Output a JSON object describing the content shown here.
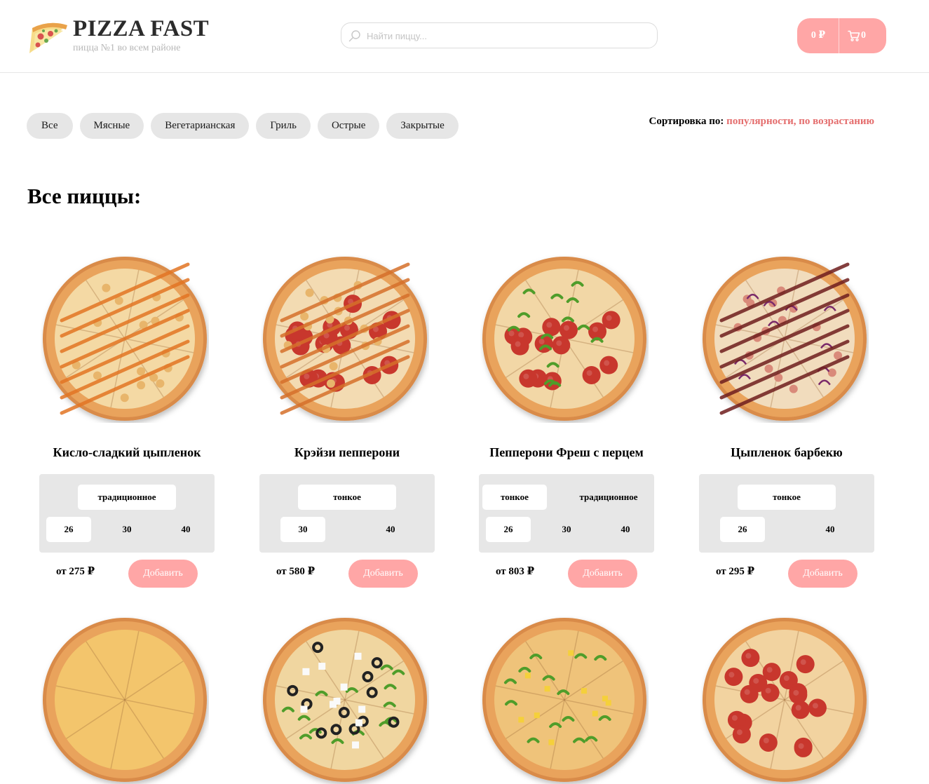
{
  "header": {
    "brand_title": "PIZZA FAST",
    "brand_subtitle": "пицца №1 во всем районе",
    "search_placeholder": "Найти пиццу...",
    "cart_total": "0 ₽",
    "cart_count": "0"
  },
  "categories": [
    "Все",
    "Мясные",
    "Вегетарианская",
    "Гриль",
    "Острые",
    "Закрытые"
  ],
  "sort": {
    "label": "Сортировка по:",
    "value": "популярности, по возрастанию"
  },
  "section_title": "Все пиццы:",
  "add_label": "Добавить",
  "colors": {
    "accent": "#ffa6a6",
    "sort_accent": "#e46c6c",
    "chip_bg": "#e6e6e6"
  },
  "pizzas": [
    {
      "name": "Кисло-сладкий цыпленок",
      "price": "от 275 ₽",
      "doughs": [
        {
          "label": "традиционное",
          "active": true
        }
      ],
      "sizes": [
        {
          "label": "26",
          "active": true
        },
        {
          "label": "30",
          "active": false
        },
        {
          "label": "40",
          "active": false
        }
      ],
      "topping": "sweet-sour-chicken"
    },
    {
      "name": "Крэйзи пепперони",
      "price": "от 580 ₽",
      "doughs": [
        {
          "label": "тонкое",
          "active": true
        }
      ],
      "sizes": [
        {
          "label": "30",
          "active": true
        },
        {
          "label": "40",
          "active": false
        }
      ],
      "topping": "crazy-pepperoni"
    },
    {
      "name": "Пепперони Фреш с перцем",
      "price": "от 803 ₽",
      "doughs": [
        {
          "label": "тонкое",
          "active": true
        },
        {
          "label": "традиционное",
          "active": false
        }
      ],
      "sizes": [
        {
          "label": "26",
          "active": true
        },
        {
          "label": "30",
          "active": false
        },
        {
          "label": "40",
          "active": false
        }
      ],
      "topping": "pepperoni-fresh"
    },
    {
      "name": "Цыпленок барбекю",
      "price": "от 295 ₽",
      "doughs": [
        {
          "label": "тонкое",
          "active": true
        }
      ],
      "sizes": [
        {
          "label": "26",
          "active": true
        },
        {
          "label": "40",
          "active": false
        }
      ],
      "topping": "bbq-chicken"
    },
    {
      "topping": "cheese"
    },
    {
      "topping": "veggie"
    },
    {
      "topping": "mexican"
    },
    {
      "topping": "pepperoni"
    }
  ]
}
